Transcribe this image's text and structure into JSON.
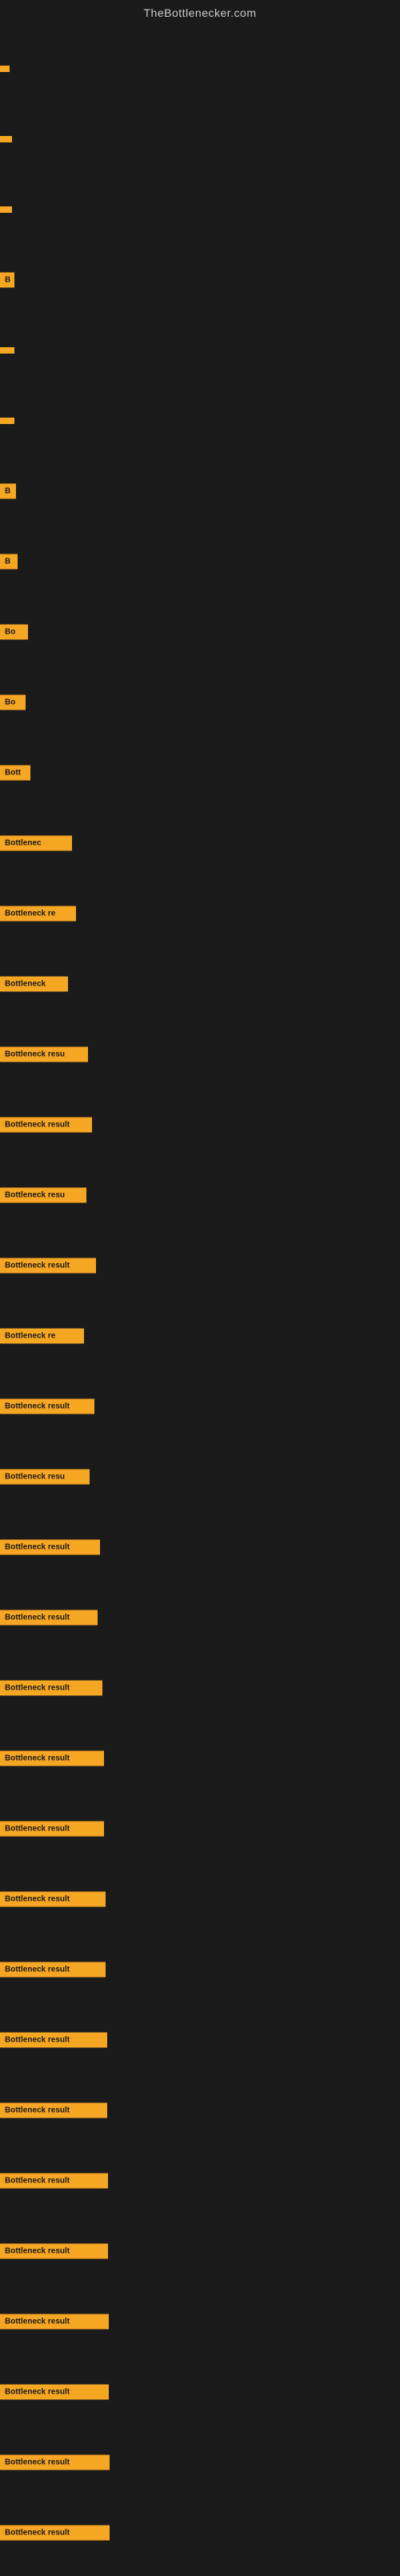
{
  "site": {
    "title": "TheBottlenecker.com"
  },
  "bars": [
    {
      "label": "",
      "width": 12
    },
    {
      "label": "",
      "width": 15
    },
    {
      "label": "",
      "width": 15
    },
    {
      "label": "B",
      "width": 18
    },
    {
      "label": "",
      "width": 18
    },
    {
      "label": "",
      "width": 18
    },
    {
      "label": "B",
      "width": 20
    },
    {
      "label": "B",
      "width": 22
    },
    {
      "label": "Bo",
      "width": 35
    },
    {
      "label": "Bo",
      "width": 32
    },
    {
      "label": "Bott",
      "width": 38
    },
    {
      "label": "Bottlenec",
      "width": 90
    },
    {
      "label": "Bottleneck re",
      "width": 95
    },
    {
      "label": "Bottleneck",
      "width": 85
    },
    {
      "label": "Bottleneck resu",
      "width": 110
    },
    {
      "label": "Bottleneck result",
      "width": 115
    },
    {
      "label": "Bottleneck resu",
      "width": 108
    },
    {
      "label": "Bottleneck result",
      "width": 120
    },
    {
      "label": "Bottleneck re",
      "width": 105
    },
    {
      "label": "Bottleneck result",
      "width": 118
    },
    {
      "label": "Bottleneck resu",
      "width": 112
    },
    {
      "label": "Bottleneck result",
      "width": 125
    },
    {
      "label": "Bottleneck result",
      "width": 122
    },
    {
      "label": "Bottleneck result",
      "width": 128
    },
    {
      "label": "Bottleneck result",
      "width": 130
    },
    {
      "label": "Bottleneck result",
      "width": 130
    },
    {
      "label": "Bottleneck result",
      "width": 132
    },
    {
      "label": "Bottleneck result",
      "width": 132
    },
    {
      "label": "Bottleneck result",
      "width": 134
    },
    {
      "label": "Bottleneck result",
      "width": 134
    },
    {
      "label": "Bottleneck result",
      "width": 135
    },
    {
      "label": "Bottleneck result",
      "width": 135
    },
    {
      "label": "Bottleneck result",
      "width": 136
    },
    {
      "label": "Bottleneck result",
      "width": 136
    },
    {
      "label": "Bottleneck result",
      "width": 137
    },
    {
      "label": "Bottleneck result",
      "width": 137
    }
  ]
}
